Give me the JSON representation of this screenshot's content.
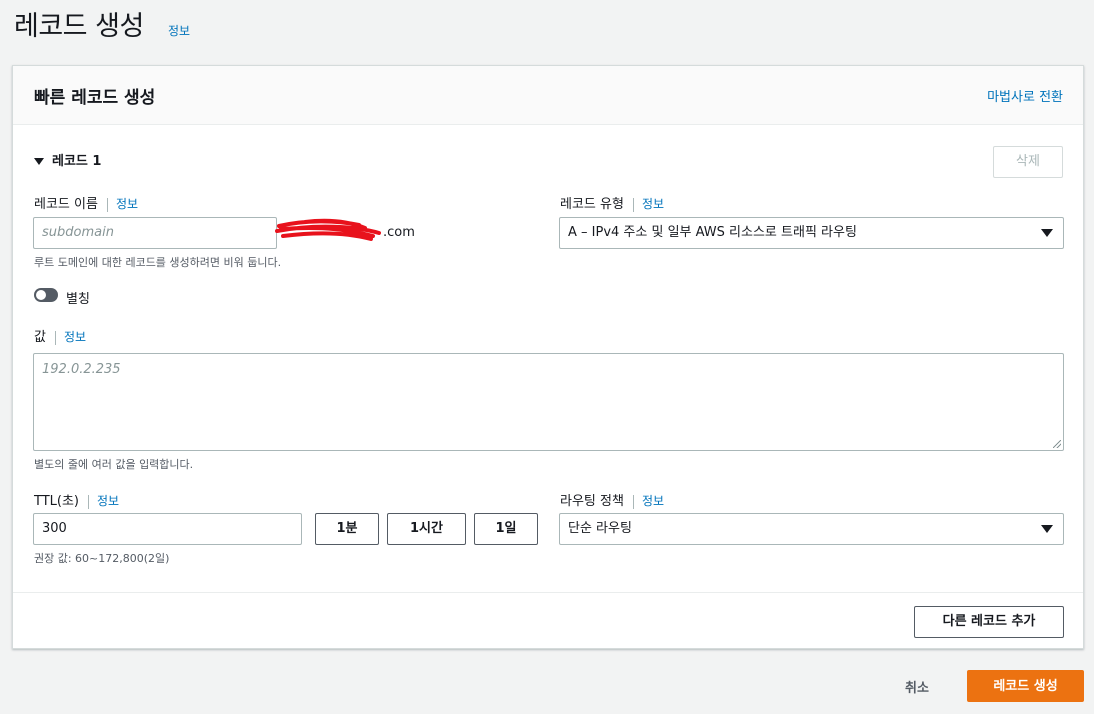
{
  "page": {
    "title": "레코드 생성",
    "info": "정보"
  },
  "panel": {
    "title": "빠른 레코드 생성",
    "wizard_link": "마법사로 전환"
  },
  "record": {
    "heading": "레코드 1",
    "delete_label": "삭제",
    "name": {
      "label": "레코드 이름",
      "info": "정보",
      "placeholder": "subdomain",
      "domain_suffix": ".com",
      "hint": "루트 도메인에 대한 레코드를 생성하려면 비워 둡니다."
    },
    "type": {
      "label": "레코드 유형",
      "info": "정보",
      "value": "A – IPv4 주소 및 일부 AWS 리소스로 트래픽 라우팅"
    },
    "alias": {
      "label": "별칭",
      "enabled": false
    },
    "value": {
      "label": "값",
      "info": "정보",
      "placeholder": "192.0.2.235",
      "hint": "별도의 줄에 여러 값을 입력합니다."
    },
    "ttl": {
      "label": "TTL(초)",
      "info": "정보",
      "value": "300",
      "presets": [
        "1분",
        "1시간",
        "1일"
      ],
      "hint": "권장 값: 60~172,800(2일)"
    },
    "routing": {
      "label": "라우팅 정책",
      "info": "정보",
      "value": "단순 라우팅"
    }
  },
  "add_record_label": "다른 레코드 추가",
  "footer": {
    "cancel_label": "취소",
    "create_label": "레코드 생성"
  },
  "colors": {
    "link": "#0073bb",
    "primary": "#ec7211",
    "redaction": "#e8121c"
  }
}
